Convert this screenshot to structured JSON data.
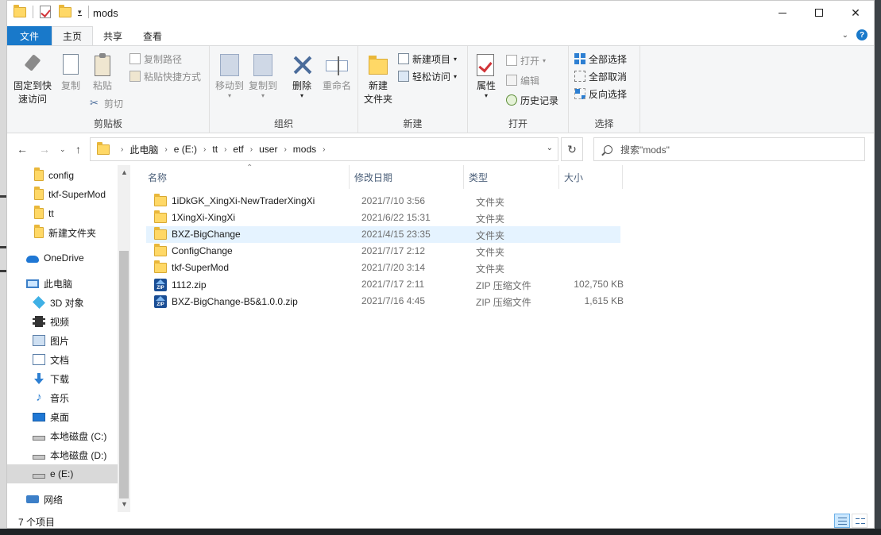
{
  "window": {
    "title": "mods",
    "minimize_glyph": "—",
    "close_glyph": "✕"
  },
  "ribbon_tabs": [
    "文件",
    "主页",
    "共享",
    "查看"
  ],
  "ribbon": {
    "clipboard": {
      "label": "剪贴板",
      "pin_quick": "固定到快",
      "pin_quick2": "速访问",
      "copy": "复制",
      "paste": "粘贴",
      "copy_path": "复制路径",
      "paste_shortcut": "粘贴快捷方式",
      "cut": "剪切"
    },
    "organize": {
      "label": "组织",
      "move_to": "移动到",
      "copy_to": "复制到",
      "delete": "删除",
      "rename": "重命名"
    },
    "new": {
      "label": "新建",
      "new_folder": "新建",
      "new_folder2": "文件夹",
      "new_item": "新建项目",
      "easy_access": "轻松访问"
    },
    "open": {
      "label": "打开",
      "properties": "属性",
      "open": "打开",
      "edit": "编辑",
      "history": "历史记录"
    },
    "select": {
      "label": "选择",
      "select_all": "全部选择",
      "select_none": "全部取消",
      "invert": "反向选择"
    }
  },
  "address": {
    "crumbs": [
      "此电脑",
      "e (E:)",
      "tt",
      "etf",
      "user",
      "mods"
    ],
    "search_placeholder": "搜索\"mods\""
  },
  "nav_pane": {
    "items": [
      {
        "label": "config",
        "icon": "folder-icon"
      },
      {
        "label": "tkf-SuperMod",
        "icon": "folder-icon"
      },
      {
        "label": "tt",
        "icon": "folder-icon"
      },
      {
        "label": "新建文件夹",
        "icon": "folder-icon"
      },
      {
        "label": "OneDrive",
        "icon": "onedrive-icon"
      },
      {
        "label": "此电脑",
        "icon": "this-pc-icon"
      },
      {
        "label": "3D 对象",
        "icon": "3d-objects-icon"
      },
      {
        "label": "视频",
        "icon": "videos-icon"
      },
      {
        "label": "图片",
        "icon": "pictures-icon"
      },
      {
        "label": "文档",
        "icon": "documents-icon"
      },
      {
        "label": "下载",
        "icon": "downloads-icon"
      },
      {
        "label": "音乐",
        "icon": "music-icon"
      },
      {
        "label": "桌面",
        "icon": "desktop-icon"
      },
      {
        "label": "本地磁盘 (C:)",
        "icon": "drive-icon"
      },
      {
        "label": "本地磁盘 (D:)",
        "icon": "drive-icon"
      },
      {
        "label": "e (E:)",
        "icon": "drive-icon"
      },
      {
        "label": "网络",
        "icon": "network-icon"
      }
    ]
  },
  "file_list": {
    "columns": [
      "名称",
      "修改日期",
      "类型",
      "大小"
    ],
    "rows": [
      {
        "name": "1iDkGK_XingXi-NewTraderXingXi",
        "date": "2021/7/10 3:56",
        "type": "文件夹",
        "size": "",
        "icon": "folder-icon"
      },
      {
        "name": "1XingXi-XingXi",
        "date": "2021/6/22 15:31",
        "type": "文件夹",
        "size": "",
        "icon": "folder-icon"
      },
      {
        "name": "BXZ-BigChange",
        "date": "2021/4/15 23:35",
        "type": "文件夹",
        "size": "",
        "icon": "folder-icon"
      },
      {
        "name": "ConfigChange",
        "date": "2021/7/17 2:12",
        "type": "文件夹",
        "size": "",
        "icon": "folder-icon"
      },
      {
        "name": "tkf-SuperMod",
        "date": "2021/7/20 3:14",
        "type": "文件夹",
        "size": "",
        "icon": "folder-icon"
      },
      {
        "name": "1112.zip",
        "date": "2021/7/17 2:11",
        "type": "ZIP 压缩文件",
        "size": "102,750 KB",
        "icon": "zip-icon"
      },
      {
        "name": "BXZ-BigChange-B5&1.0.0.zip",
        "date": "2021/7/16 4:45",
        "type": "ZIP 压缩文件",
        "size": "1,615 KB",
        "icon": "zip-icon"
      }
    ]
  },
  "status": {
    "item_count": "7 个项目"
  },
  "colors": {
    "file_tab": "#1979ca",
    "hover_row": "#e5f3ff",
    "folder": "#ffd866"
  }
}
